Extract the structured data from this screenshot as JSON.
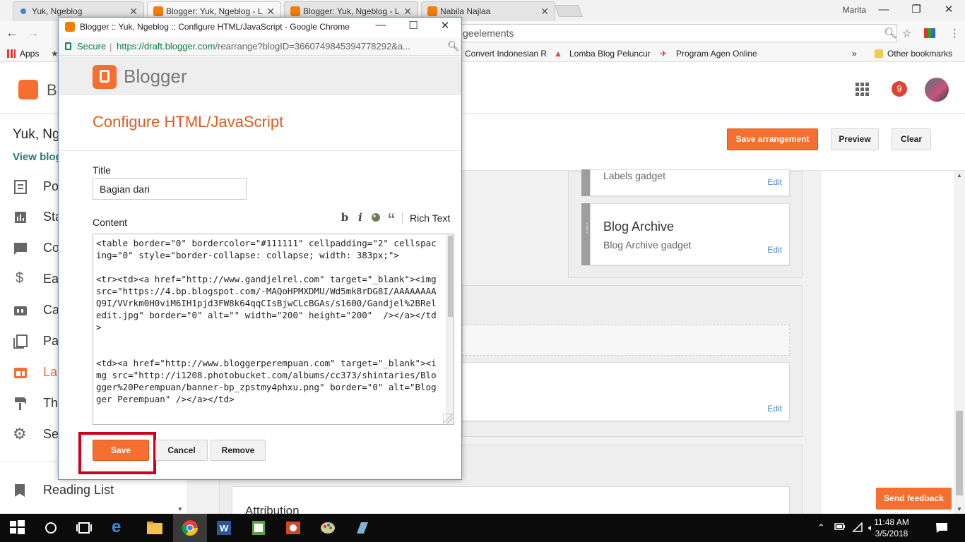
{
  "browser": {
    "tabs": [
      {
        "title": "Yuk, Ngeblog"
      },
      {
        "title": "Blogger: Yuk, Ngeblog - L"
      },
      {
        "title": "Blogger: Yuk, Ngeblog - L"
      },
      {
        "title": "Nabila Najlaa"
      }
    ],
    "user": "Marita",
    "address_fragment": "geelements",
    "bookmarks": {
      "apps": "Apps",
      "items": [
        "Convert Indonesian R",
        "Lomba Blog Peluncur",
        "Program Agen Online"
      ],
      "more": "»",
      "other": "Other bookmarks"
    }
  },
  "blogger_page": {
    "logo_letter": "B",
    "notifications": "9",
    "blog_name": "Yuk, Ng",
    "view_blog": "View blog",
    "sidebar": [
      {
        "label": "Po",
        "icon": "posts-icon"
      },
      {
        "label": "Sta",
        "icon": "stats-icon"
      },
      {
        "label": "Co",
        "icon": "comments-icon"
      },
      {
        "label": "Ea",
        "icon": "earnings-icon"
      },
      {
        "label": "Ca",
        "icon": "campaigns-icon"
      },
      {
        "label": "Pa",
        "icon": "pages-icon"
      },
      {
        "label": "La",
        "icon": "layout-icon",
        "active": true
      },
      {
        "label": "Th",
        "icon": "theme-icon"
      },
      {
        "label": "Se",
        "icon": "settings-icon"
      }
    ],
    "reading_list": "Reading List",
    "actions": {
      "save_arrangement": "Save arrangement",
      "preview": "Preview",
      "clear": "Clear"
    },
    "gadgets": [
      {
        "title": "",
        "subtitle": "Labels gadget",
        "edit": "Edit"
      },
      {
        "title": "Blog Archive",
        "subtitle": "Blog Archive gadget",
        "edit": "Edit"
      },
      {
        "title": "",
        "subtitle": "",
        "edit": "Edit"
      },
      {
        "title": "Attribution",
        "subtitle": "",
        "edit": ""
      }
    ],
    "send_feedback": "Send feedback"
  },
  "popup": {
    "window_title": "Blogger :: Yuk, Ngeblog :: Configure HTML/JavaScript - Google Chrome",
    "secure_label": "Secure",
    "url_main": "https://draft.blogger.com",
    "url_rest": "/rearrange?blogID=3660749845394778292&a...",
    "brand": "Blogger",
    "heading": "Configure HTML/JavaScript",
    "title_label": "Title",
    "title_value": "Bagian dari",
    "content_label": "Content",
    "toolbar": {
      "bold": "b",
      "italic": "i",
      "quote": "“",
      "rich_text": "Rich Text"
    },
    "content_value": "<table border=\"0\" bordercolor=\"#111111\" cellpadding=\"2\" cellspacing=\"0\" style=\"border-collapse: collapse; width: 383px;\">\n\n<tr><td><a href=\"http://www.gandjelrel.com\" target=\"_blank\"><img src=\"https://4.bp.blogspot.com/-MAQoHPMXDMU/Wd5mk8rDG8I/AAAAAAAAQ9I/VVrkm0H0viM6IH1pjd3FW8k64qqCIsBjwCLcBGAs/s1600/Gandjel%2BReledit.jpg\" border=\"0\" alt=\"\" width=\"200\" height=\"200\"  /></a></td>\n\n\n<td><a href=\"http://www.bloggerperempuan.com\" target=\"_blank\"><img src=\"http://i1208.photobucket.com/albums/cc373/shintaries/Blogger%20Perempuan/banner-bp_zpstmy4phxu.png\" border=\"0\" alt=\"Blogger Perempuan\" /></a></td>",
    "buttons": {
      "save": "Save",
      "cancel": "Cancel",
      "remove": "Remove"
    }
  },
  "taskbar": {
    "time": "11:48 AM",
    "date": "3/5/2018"
  },
  "colors": {
    "blogger_orange": "#f46f30",
    "highlight_red": "#d0021b",
    "secure_green": "#0b8043"
  }
}
